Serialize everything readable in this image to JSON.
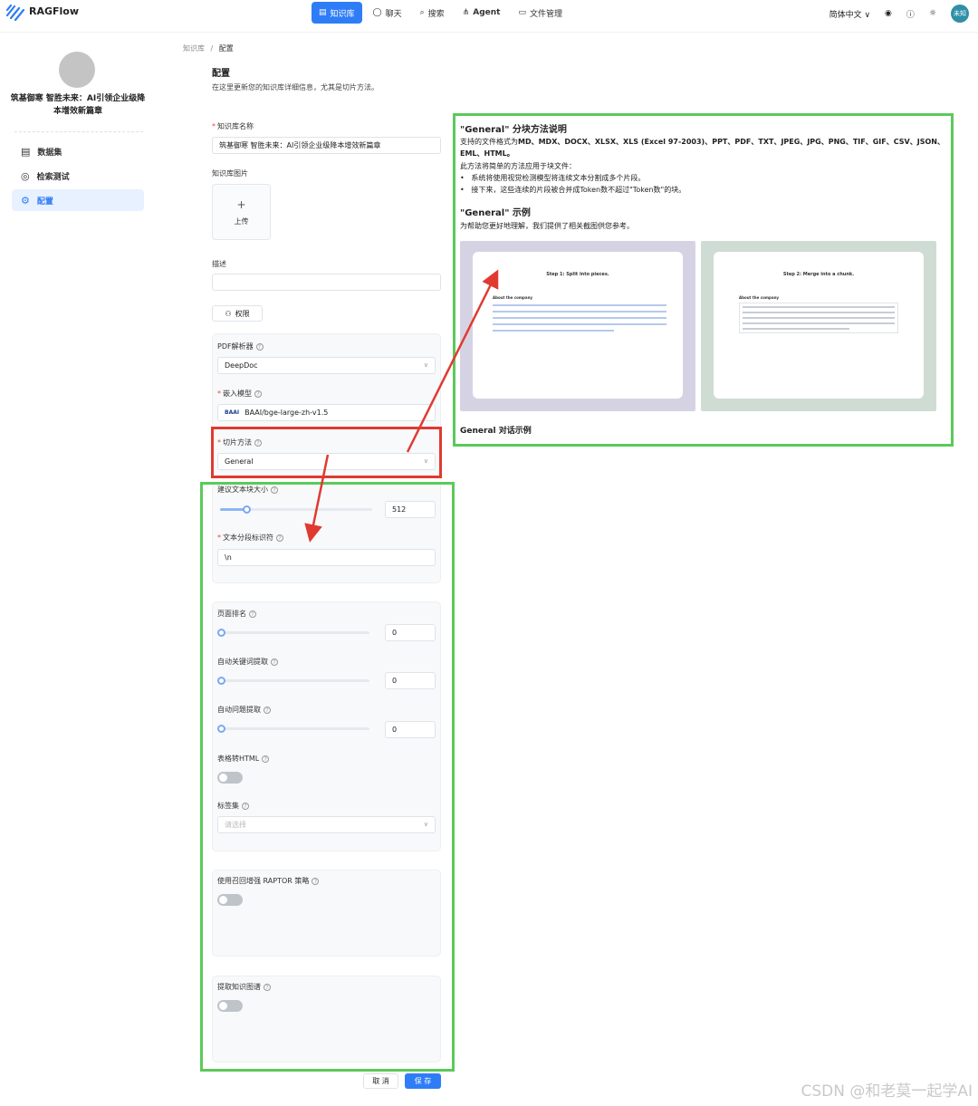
{
  "app": {
    "name": "RAGFlow"
  },
  "nav": [
    {
      "label": "知识库",
      "icon": "database-icon",
      "active": true
    },
    {
      "label": "聊天",
      "icon": "chat-icon",
      "active": false
    },
    {
      "label": "搜索",
      "icon": "search-icon",
      "active": false
    },
    {
      "label": "Agent",
      "icon": "agent-icon",
      "active": false
    },
    {
      "label": "文件管理",
      "icon": "folder-icon",
      "active": false
    }
  ],
  "tools": {
    "language": "简体中文",
    "user": "未知"
  },
  "sidebar": {
    "kb_name": "筑基御寒 智胜未来：AI引领企业级降本增效新篇章",
    "items": [
      {
        "label": "数据集",
        "icon": "dataset-icon",
        "active": false
      },
      {
        "label": "检索测试",
        "icon": "retrieval-test-icon",
        "active": false
      },
      {
        "label": "配置",
        "icon": "gear-icon",
        "active": true
      }
    ]
  },
  "breadcrumb": {
    "root": "知识库",
    "sep": "/",
    "current": "配置"
  },
  "page": {
    "title": "配置",
    "subtitle": "在这里更新您的知识库详细信息，尤其是切片方法。"
  },
  "form": {
    "kb_name_label": "知识库名称",
    "kb_name_value": "筑基御寒 智胜未来：AI引领企业级降本增效新篇章",
    "kb_image_label": "知识库图片",
    "upload_plus": "+",
    "upload_label": "上传",
    "desc_label": "描述",
    "desc_value": "",
    "permission_label": "权限",
    "pdf_parser_label": "PDF解析器",
    "pdf_parser_value": "DeepDoc",
    "embedding_label": "嵌入模型",
    "embedding_value": "BAAI/bge-large-zh-v1.5",
    "embedding_logo": "BAAI",
    "chunk_method_label": "切片方法",
    "chunk_method_value": "General",
    "chunk_size_label": "建议文本块大小",
    "chunk_size_value": "512",
    "chunk_size_fraction": 0.17,
    "delimiter_label": "文本分段标识符",
    "delimiter_value": "\\n",
    "page_rank_label": "页面排名",
    "page_rank_value": "0",
    "auto_keywords_label": "自动关键词提取",
    "auto_keywords_value": "0",
    "auto_questions_label": "自动问题提取",
    "auto_questions_value": "0",
    "html4excel_label": "表格转HTML",
    "tagset_label": "标签集",
    "tagset_placeholder": "请选择",
    "raptor_label": "使用召回增强 RAPTOR 策略",
    "graph_label": "提取知识图谱",
    "cancel": "取 消",
    "save": "保 存"
  },
  "explain": {
    "title": "\"General\" 分块方法说明",
    "formats_prefix": "支持的文件格式为",
    "formats": "MD、MDX、DOCX、XLSX、XLS (Excel 97-2003)、PPT、PDF、TXT、JPEG、JPG、PNG、TIF、GIF、CSV、JSON、EML、HTML。",
    "intro": "此方法将简单的方法应用于块文件：",
    "bullet1": "系统将使用视觉检测模型将连续文本分割成多个片段。",
    "bullet2": "接下来，这些连续的片段被合并成Token数不超过\"Token数\"的块。",
    "example_title": "\"General\" 示例",
    "example_desc": "为帮助您更好地理解，我们提供了相关截图供您参考。",
    "shot1_title": "Step 1: Split into pieces.",
    "shot1_sub": "About the company",
    "shot2_title": "Step 2: Merge into a chunk.",
    "shot2_sub": "About the company",
    "footer": "General 对话示例"
  },
  "colors": {
    "accent": "#2f7df6",
    "annotation_green": "#5cc95a",
    "annotation_red": "#e03a30"
  },
  "watermark": "CSDN @和老莫一起学AI"
}
